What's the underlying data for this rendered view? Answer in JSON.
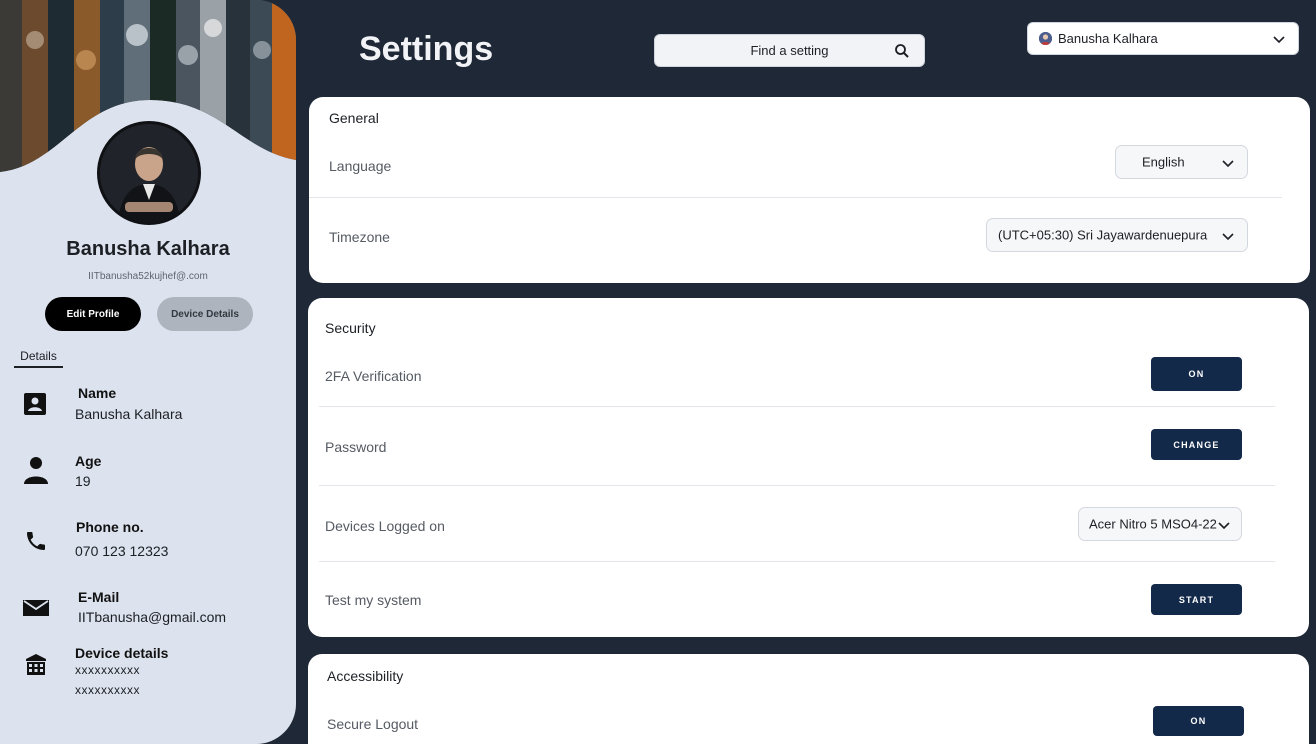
{
  "profile": {
    "name": "Banusha Kalhara",
    "email": "IITbanusha52kujhef@.com",
    "edit_label": "Edit Profile",
    "device_label": "Device Details",
    "details_tab": "Details",
    "details": [
      {
        "title": "Name",
        "value": "Banusha Kalhara",
        "icon": "contact-card-icon"
      },
      {
        "title": "Age",
        "value": "19",
        "icon": "person-icon"
      },
      {
        "title": "Phone no.",
        "value": "070 123 12323",
        "icon": "phone-icon"
      },
      {
        "title": "E-Mail",
        "value": "IITbanusha@gmail.com",
        "icon": "mail-icon"
      },
      {
        "title": "Device details",
        "value": "xxxxxxxxxx",
        "value2": "xxxxxxxxxx",
        "icon": "building-icon"
      }
    ]
  },
  "header": {
    "title": "Settings",
    "search_placeholder": "Find a setting",
    "user_name": "Banusha Kalhara"
  },
  "general": {
    "title": "General",
    "language_label": "Language",
    "language_value": "English",
    "timezone_label": "Timezone",
    "timezone_value": "(UTC+05:30) Sri Jayawardenuepura"
  },
  "security": {
    "title": "Security",
    "twofa_label": "2FA Verification",
    "twofa_button": "ON",
    "password_label": "Password",
    "password_button": "CHANGE",
    "devices_label": "Devices Logged on",
    "devices_value": "Acer Nitro 5 MSO4-22",
    "test_label": "Test my system",
    "test_button": "START"
  },
  "accessibility": {
    "title": "Accessibility",
    "logout_label": "Secure Logout",
    "logout_button": "ON"
  },
  "colors": {
    "background": "#1f2836",
    "panel": "#dde3ee",
    "button_dark": "#13294a"
  }
}
